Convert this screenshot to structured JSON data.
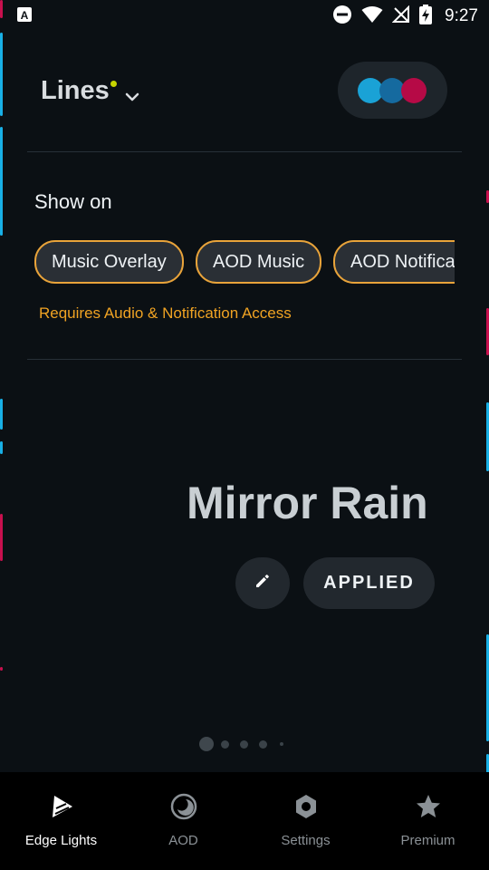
{
  "status_bar": {
    "time": "9:27",
    "icons": [
      "a-badge-icon",
      "dnd-icon",
      "wifi-icon",
      "no-signal-icon",
      "battery-charging-icon"
    ]
  },
  "header": {
    "theme_title": "Lines",
    "dropdown_icon": "chevron-down-icon",
    "color_dots": [
      "#1aa2d6",
      "#156a9f",
      "#b60a46"
    ]
  },
  "show_on": {
    "label": "Show on",
    "chips": [
      "Music Overlay",
      "AOD Music",
      "AOD Notifications"
    ],
    "requires_text": "Requires Audio & Notification Access"
  },
  "effect": {
    "name": "Mirror Rain",
    "edit_icon": "pencil-icon",
    "applied_label": "APPLIED"
  },
  "pager": {
    "count": 5,
    "active_index": 0
  },
  "bottom_nav": {
    "items": [
      {
        "label": "Edge Lights",
        "icon": "edge-lights-icon",
        "active": true
      },
      {
        "label": "AOD",
        "icon": "moon-icon",
        "active": false
      },
      {
        "label": "Settings",
        "icon": "gear-icon",
        "active": false
      },
      {
        "label": "Premium",
        "icon": "star-icon",
        "active": false
      }
    ]
  },
  "colors": {
    "background": "#0b1014",
    "accent_orange": "#e8a33a",
    "edge_cyan": "#18b0e6",
    "edge_pink": "#c8104e"
  }
}
